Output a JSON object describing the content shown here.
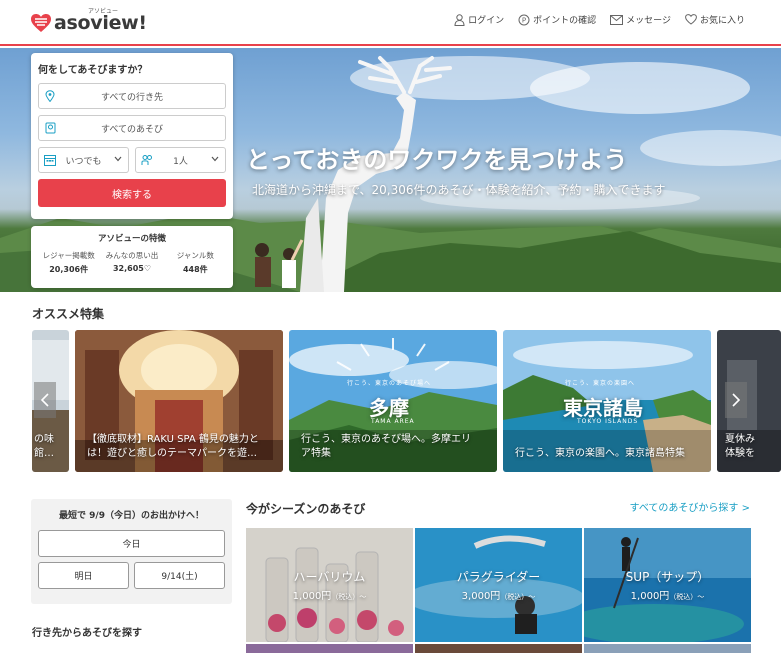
{
  "colors": {
    "brand": "#e8414b",
    "link": "#1a9fc4"
  },
  "header": {
    "logo_text": "asoview!",
    "logo_ruby": "アソビュー",
    "nav": [
      {
        "label": "ログイン",
        "icon": "user-icon"
      },
      {
        "label": "ポイントの確認",
        "icon": "points-icon"
      },
      {
        "label": "メッセージ",
        "icon": "mail-icon"
      },
      {
        "label": "お気に入り",
        "icon": "heart-icon"
      }
    ]
  },
  "hero": {
    "title": "とっておきのワクワクを見つけよう",
    "subtitle": "北海道から沖縄まで、20,306件のあそび・体験を紹介、予約・購入できます"
  },
  "search": {
    "title": "何をしてあそびますか？",
    "destination_placeholder": "すべての行き先",
    "activity_placeholder": "すべてのあそび",
    "date_value": "いつでも",
    "people_value": "1人",
    "submit_label": "検索する"
  },
  "features": {
    "title": "アソビューの特徴",
    "stats": [
      {
        "label": "レジャー掲載数",
        "value": "20,306件"
      },
      {
        "label": "みんなの思い出",
        "value": "32,605♡"
      },
      {
        "label": "ジャンル数",
        "value": "448件"
      }
    ]
  },
  "recommended": {
    "title": "オススメ特集",
    "cards": [
      {
        "caption": "の味\n館…"
      },
      {
        "caption": "【徹底取材】RAKU SPA 鶴見の魅力と\nは！遊びと癒しのテーマパークを遊…"
      },
      {
        "caption": "行こう、東京のあそび場へ。多摩エリ\nア特集",
        "big_name": "多摩",
        "ruby_top": "行こう、東京のあそび場へ",
        "ruby_bottom": "TAMA AREA"
      },
      {
        "caption": "行こう、東京の楽園へ。東京諸島特集",
        "big_name": "東京諸島",
        "ruby_top": "行こう、東京の楽園へ",
        "ruby_bottom": "TOKYO ISLANDS"
      },
      {
        "caption": "夏休み\n体験を"
      }
    ]
  },
  "today": {
    "title": "最短で 9/9（今日）のお出かけへ！",
    "today_label": "今日",
    "tomorrow_label": "明日",
    "date_label": "9/14(土)"
  },
  "area_title": "行き先からあそびを探す",
  "season": {
    "title": "今がシーズンのあそび",
    "see_all": "すべてのあそびから探す >",
    "cards": [
      {
        "name": "ハーバリウム",
        "price": "1,000円",
        "tax": "（税込）～"
      },
      {
        "name": "パラグライダー",
        "price": "3,000円",
        "tax": "（税込）～"
      },
      {
        "name": "SUP（サップ）",
        "price": "1,000円",
        "tax": "（税込）～"
      }
    ]
  }
}
